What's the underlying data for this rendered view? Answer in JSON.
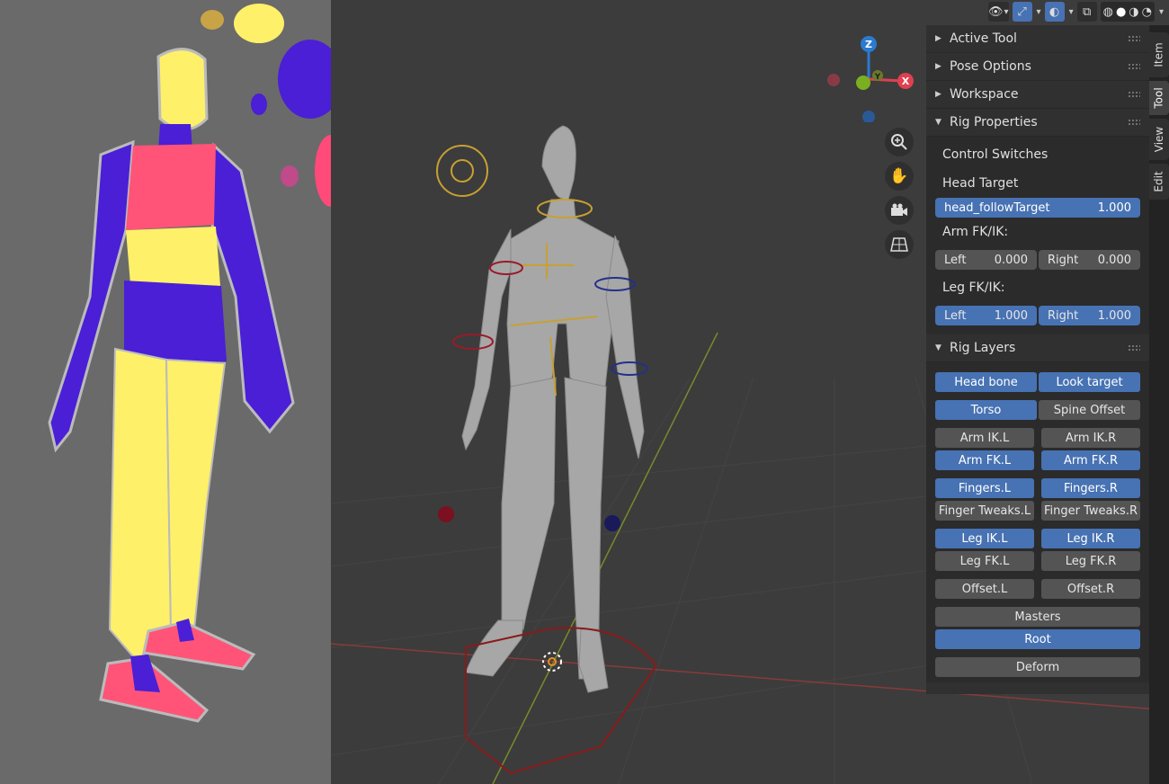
{
  "header_icons": [
    "visibility-icon",
    "gizmo-icon",
    "overlay-icon",
    "xray-icon",
    "wireframe-shading-icon",
    "solid-shading-icon",
    "material-shading-icon",
    "rendered-shading-icon"
  ],
  "gizmo": {
    "z": "Z",
    "y": "Y",
    "x": "X"
  },
  "panels": {
    "active_tool": "Active Tool",
    "pose_options": "Pose Options",
    "workspace": "Workspace",
    "rig_properties": "Rig Properties",
    "rig_layers": "Rig Layers"
  },
  "rig_properties": {
    "control_switches": "Control Switches",
    "head_target": "Head Target",
    "head_follow": {
      "label": "head_followTarget",
      "value": "1.000"
    },
    "arm_fkik": "Arm FK/IK:",
    "arm_left": {
      "label": "Left",
      "value": "0.000"
    },
    "arm_right": {
      "label": "Right",
      "value": "0.000"
    },
    "leg_fkik": "Leg FK/IK:",
    "leg_left": {
      "label": "Left",
      "value": "1.000"
    },
    "leg_right": {
      "label": "Right",
      "value": "1.000"
    }
  },
  "rig_layers": [
    [
      "Head bone",
      "Look target"
    ],
    [
      "Torso",
      "Spine Offset"
    ],
    [
      "Arm IK.L",
      "Arm IK.R"
    ],
    [
      "Arm FK.L",
      "Arm FK.R"
    ],
    [
      "Fingers.L",
      "Fingers.R"
    ],
    [
      "Finger Tweaks.L",
      "Finger Tweaks.R"
    ],
    [
      "Leg IK.L",
      "Leg IK.R"
    ],
    [
      "Leg FK.L",
      "Leg FK.R"
    ],
    [
      "Offset.L",
      "Offset.R"
    ],
    [
      "Masters"
    ],
    [
      "Root"
    ],
    [
      "Deform"
    ]
  ],
  "tabs": [
    "Item",
    "Tool",
    "View",
    "Edit"
  ],
  "colors": {
    "accent": "#4772b3",
    "panel": "#303030",
    "viewport": "#3c3c3c"
  }
}
